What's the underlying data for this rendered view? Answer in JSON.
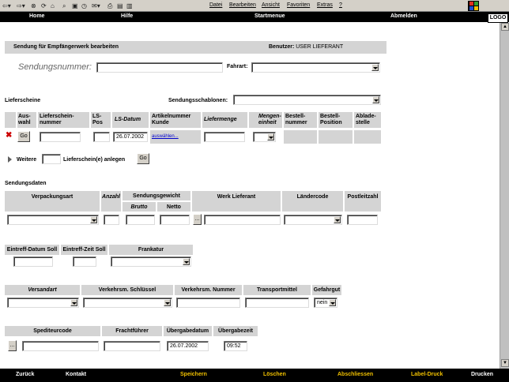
{
  "browser": {
    "menu": [
      "Datei",
      "Bearbeiten",
      "Ansicht",
      "Favoriten",
      "Extras",
      "?"
    ]
  },
  "topnav": {
    "home": "Home",
    "hilfe": "Hilfe",
    "startmenue": "Startmenue",
    "abmelden": "Abmelden",
    "logo": "LOGO"
  },
  "header": {
    "title": "Sendung für Empfängerwerk bearbeiten",
    "user": "Benutzer: USER LIEFERANT"
  },
  "sendung": {
    "label": "Sendungsnummer:",
    "value": "",
    "fahrart_label": "Fahrart:",
    "fahrart_value": ""
  },
  "lieferscheine": {
    "title": "Lieferscheine",
    "schablonen_label": "Sendungsschablonen:",
    "schablonen_value": "",
    "columns": {
      "auswahl": "Aus-\nwahl",
      "lsnummer": "Lieferschein-\nnummer",
      "lspos": "LS-\nPos",
      "lsdatum": "LS-Datum",
      "artikel": "Artikelnummer\nKunde",
      "liefermenge": "Liefermenge",
      "mengeneinheit": "Mengen-\neinheit",
      "bestellnummer": "Bestell-\nnummer",
      "bestellposition": "Bestell-\nPosition",
      "abladestelle": "Ablade-\nstelle"
    },
    "row": {
      "go_label": "Go",
      "lsnummer": "",
      "lspos": "",
      "lsdatum": "26.07.2002",
      "artikel_link": "auswählen...",
      "liefermenge": "",
      "mengeneinheit": ""
    },
    "weitere_label": "Weitere",
    "weitere_value": "",
    "anlegen_label": "Lieferschein(e) anlegen",
    "go_label": "Go"
  },
  "sendungsdaten": {
    "title": "Sendungsdaten",
    "cols": {
      "verpackungsart": "Verpackungsart",
      "anzahl": "Anzahl",
      "gewicht": "Sendungsgewicht",
      "brutto": "Brutto",
      "netto": "Netto",
      "werk": "Werk Lieferant",
      "laendercode": "Ländercode",
      "plz": "Postleitzahl"
    },
    "dots": "...",
    "eintreff_datum": "Eintreff-Datum Soll",
    "eintreff_zeit": "Eintreff-Zeit Soll",
    "frankatur": "Frankatur",
    "versandart": "Versandart",
    "verkehrsschluessel": "Verkehrsm. Schlüssel",
    "verkehrsnummer": "Verkehrsm. Nummer",
    "transportmittel": "Transportmittel",
    "gefahrgut": "Gefahrgut",
    "gefahrgut_value": "nein",
    "spediteurcode": "Spediteurcode",
    "frachtfuehrer": "Frachtführer",
    "uebergabedatum": "Übergabedatum",
    "uebergabedatum_value": "26.07.2002",
    "uebergabezeit": "Übergabezeit",
    "uebergabezeit_value": "09:52"
  },
  "bottomnav": {
    "zurueck": "Zurück",
    "kontakt": "Kontakt",
    "speichern": "Speichern",
    "loeschen": "Löschen",
    "abschliessen": "Abschliessen",
    "labeldruck": "Label-Druck",
    "drucken": "Drucken"
  },
  "colors": {
    "nav_bg": "#000000",
    "nav_white": "#ffffff",
    "nav_orange": "#f0c000",
    "header_grey": "#d4d4d4",
    "delete_red": "#cc0000"
  }
}
